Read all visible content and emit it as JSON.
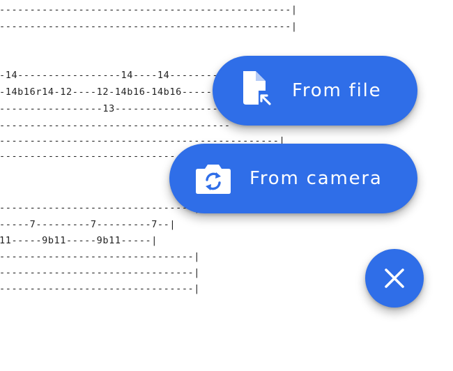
{
  "tab": {
    "lines": [
      "------------------------------------------------|",
      "------------------------------------------------|",
      "-14-----------------14----14----------",
      "-14b16r14-12----12-14b16-14b16--------",
      "-----------------13-------------------",
      "--------------------------------------",
      "----------------------------------------------|",
      "--------------------------------------",
      "--------------------------------|",
      "-----7---------7---------7--|",
      "11-----9b11-----9b11-----|",
      "--------------------------------|",
      "--------------------------------|",
      "--------------------------------|"
    ]
  },
  "fab_menu": {
    "from_file": {
      "label": "From file",
      "icon": "file-import-icon"
    },
    "from_camera": {
      "label": "From camera",
      "icon": "camera-switch-icon"
    },
    "close": {
      "icon": "close-icon"
    }
  },
  "colors": {
    "accent": "#2f6ee8",
    "text": "#222222"
  }
}
